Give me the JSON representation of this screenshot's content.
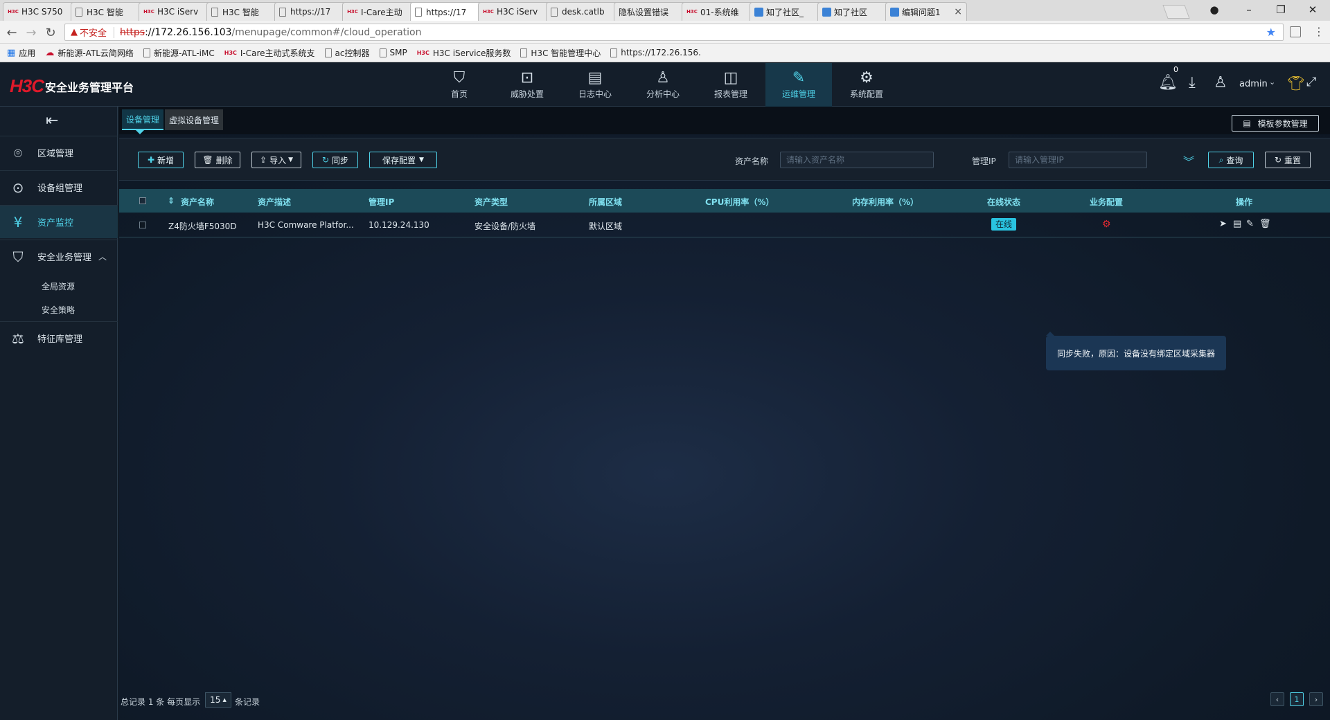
{
  "browser": {
    "tabs": [
      {
        "title": "H3C S750",
        "icon": "h3c-favicon",
        "active": false
      },
      {
        "title": "H3C 智能",
        "icon": "doc-icon",
        "active": false
      },
      {
        "title": "H3C iServ",
        "icon": "h3c-favicon",
        "active": false
      },
      {
        "title": "H3C 智能",
        "icon": "doc-icon",
        "active": false
      },
      {
        "title": "https://17",
        "icon": "doc-icon",
        "active": false
      },
      {
        "title": "I-Care主动",
        "icon": "h3c-favicon",
        "active": false
      },
      {
        "title": "https://17",
        "icon": "doc-icon",
        "active": true
      },
      {
        "title": "H3C iServ",
        "icon": "h3c-favicon",
        "active": false
      },
      {
        "title": "desk.catlb",
        "icon": "doc-icon",
        "active": false
      },
      {
        "title": "隐私设置错误",
        "icon": "none",
        "active": false
      },
      {
        "title": "01-系统维",
        "icon": "h3c-favicon",
        "active": false
      },
      {
        "title": "知了社区_",
        "icon": "blue-favicon",
        "active": false
      },
      {
        "title": "知了社区",
        "icon": "blue-favicon",
        "active": false
      },
      {
        "title": "编辑问题1",
        "icon": "blue-favicon",
        "active": false
      }
    ],
    "address": {
      "not_secure": "不安全",
      "scheme": "https",
      "host": "://172.26.156.103",
      "path": "/menupage/common#/cloud_operation"
    },
    "bookmarks": [
      {
        "label": "应用",
        "icon": "apps-grid-icon"
      },
      {
        "label": "新能源-ATL云简网络",
        "icon": "cloud-icon"
      },
      {
        "label": "新能源-ATL-iMC",
        "icon": "doc-icon"
      },
      {
        "label": "I-Care主动式系统支",
        "icon": "h3c-favicon"
      },
      {
        "label": "ac控制器",
        "icon": "doc-icon"
      },
      {
        "label": "SMP",
        "icon": "doc-icon"
      },
      {
        "label": "H3C iService服务数",
        "icon": "h3c-favicon"
      },
      {
        "label": "H3C 智能管理中心",
        "icon": "doc-icon"
      },
      {
        "label": "https://172.26.156.",
        "icon": "doc-icon"
      }
    ]
  },
  "app": {
    "logo": "H3C",
    "title": "安全业务管理平台",
    "nav": [
      {
        "label": "首页",
        "icon": "shield-home-icon",
        "active": false
      },
      {
        "label": "威胁处置",
        "icon": "threat-icon",
        "active": false
      },
      {
        "label": "日志中心",
        "icon": "clipboard-icon",
        "active": false
      },
      {
        "label": "分析中心",
        "icon": "user-analysis-icon",
        "active": false
      },
      {
        "label": "报表管理",
        "icon": "chart-icon",
        "active": false
      },
      {
        "label": "运维管理",
        "icon": "edit-icon",
        "active": true
      },
      {
        "label": "系统配置",
        "icon": "gear-icon",
        "active": false
      }
    ],
    "notifications_count": "0",
    "username": "admin"
  },
  "sidebar": {
    "items": [
      {
        "label": "区域管理",
        "icon": "location-icon"
      },
      {
        "label": "设备组管理",
        "icon": "device-group-icon"
      },
      {
        "label": "资产监控",
        "icon": "asset-icon"
      },
      {
        "label": "安全业务管理",
        "icon": "security-icon"
      },
      {
        "label": "特征库管理",
        "icon": "signature-icon"
      }
    ],
    "sub_items": [
      {
        "label": "全局资源"
      },
      {
        "label": "安全策略"
      }
    ]
  },
  "main": {
    "tabs": [
      {
        "label": "设备管理",
        "active": true
      },
      {
        "label": "虚拟设备管理",
        "active": false
      }
    ],
    "template_button": "模板参数管理",
    "toolbar": {
      "add": "新增",
      "delete": "删除",
      "import": "导入",
      "sync": "同步",
      "save_config": "保存配置"
    },
    "filters": {
      "asset_name_label": "资产名称",
      "asset_name_placeholder": "请输入资产名称",
      "mgmt_ip_label": "管理IP",
      "mgmt_ip_placeholder": "请输入管理IP",
      "query": "查询",
      "reset": "重置"
    },
    "table": {
      "columns": [
        "资产名称",
        "资产描述",
        "管理IP",
        "资产类型",
        "所属区域",
        "CPU利用率（%）",
        "内存利用率（%）",
        "在线状态",
        "业务配置",
        "操作"
      ],
      "rows": [
        {
          "name": "Z4防火墙F5030D",
          "description": "H3C Comware Platfor...",
          "ip": "10.129.24.130",
          "type": "安全设备/防火墙",
          "region": "默认区域",
          "cpu": "",
          "memory": "",
          "status": "在线"
        }
      ]
    },
    "tooltip": "同步失败，原因：设备没有绑定区域采集器",
    "pagination": {
      "total_text": "总记录 1 条 每页显示",
      "page_size": "15",
      "suffix_text": "条记录",
      "prev": "‹",
      "current": "1",
      "next": "›"
    }
  },
  "colors": {
    "accent": "#4fd2e8",
    "header_bg": "#141e2a",
    "table_header_bg": "#1c4a58",
    "status_online": "#29c3e0",
    "error_red": "#e22a32"
  }
}
